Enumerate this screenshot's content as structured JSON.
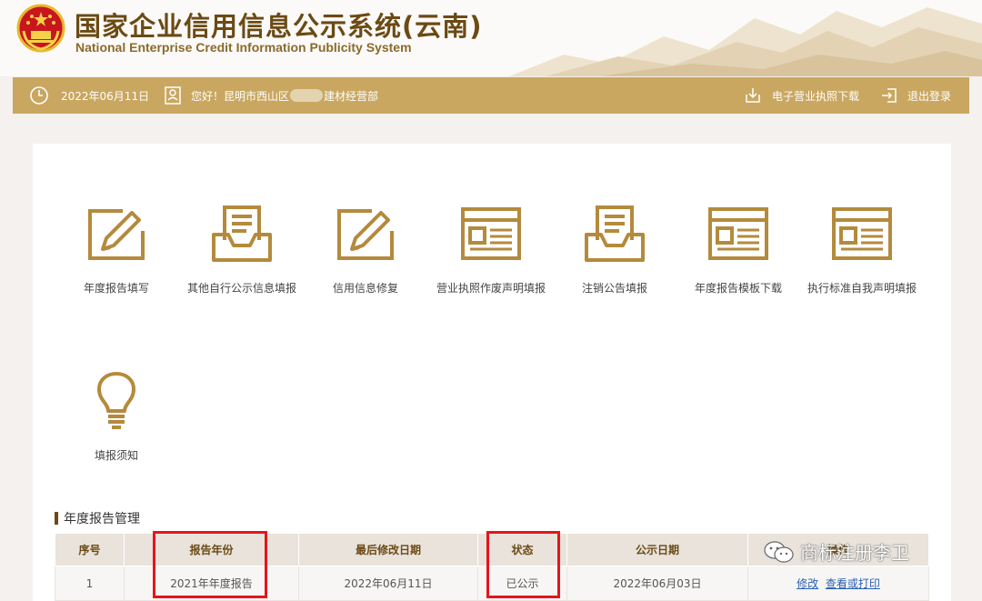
{
  "header": {
    "title": "国家企业信用信息公示系统(云南)",
    "subtitle": "National Enterprise Credit Information Publicity System"
  },
  "topbar": {
    "date": "2022年06月11日",
    "greeting_prefix": "您好！昆明市西山区",
    "greeting_suffix": "建材经营部",
    "license_download": "电子营业执照下载",
    "logout": "退出登录"
  },
  "functions": [
    {
      "label": "年度报告填写",
      "icon": "edit-icon"
    },
    {
      "label": "其他自行公示信息填报",
      "icon": "inbox-icon"
    },
    {
      "label": "信用信息修复",
      "icon": "edit-icon"
    },
    {
      "label": "营业执照作废声明填报",
      "icon": "document-window-icon"
    },
    {
      "label": "注销公告填报",
      "icon": "inbox-icon"
    },
    {
      "label": "年度报告模板下载",
      "icon": "document-window-icon"
    },
    {
      "label": "执行标准自我声明填报",
      "icon": "document-window-icon"
    },
    {
      "label": "填报须知",
      "icon": "lightbulb-icon"
    }
  ],
  "report_section": {
    "title": "年度报告管理",
    "columns": [
      "序号",
      "报告年份",
      "最后修改日期",
      "状态",
      "公示日期",
      "操作"
    ],
    "rows": [
      {
        "index": "1",
        "year": "2021年年度报告",
        "modified": "2022年06月11日",
        "status": "已公示",
        "published": "2022年06月03日",
        "action_edit": "修改",
        "action_view": "查看或打印"
      }
    ]
  },
  "watermark": "商标注册李卫",
  "colors": {
    "brand_gold": "#c9a760",
    "brand_brown": "#6b4a14",
    "highlight_red": "#e8141b",
    "link_blue": "#2a5fb3"
  }
}
